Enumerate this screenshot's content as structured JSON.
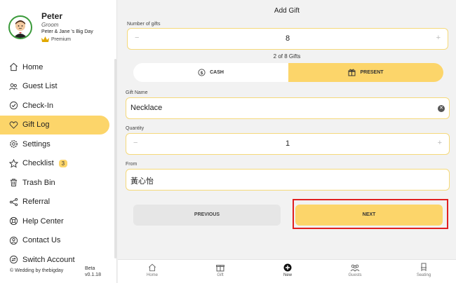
{
  "profile": {
    "name": "Peter",
    "role": "Groom",
    "event": "Peter & Jane 's Big Day",
    "badge": "Premium"
  },
  "sidebar": {
    "items": [
      {
        "label": "Home",
        "icon": "home-icon"
      },
      {
        "label": "Guest List",
        "icon": "guests-icon"
      },
      {
        "label": "Check-In",
        "icon": "check-circle-icon"
      },
      {
        "label": "Gift Log",
        "icon": "heart-icon",
        "active": true
      },
      {
        "label": "Settings",
        "icon": "gear-icon"
      },
      {
        "label": "Checklist",
        "icon": "star-icon",
        "badge": "3"
      },
      {
        "label": "Trash Bin",
        "icon": "trash-icon"
      },
      {
        "label": "Referral",
        "icon": "share-icon"
      },
      {
        "label": "Help Center",
        "icon": "help-icon"
      },
      {
        "label": "Contact Us",
        "icon": "contact-icon"
      },
      {
        "label": "Switch Account",
        "icon": "switch-icon"
      }
    ],
    "footer_copy": "© Wedding by thebigday",
    "footer_beta": "Beta",
    "footer_version": "v0.1.18"
  },
  "main": {
    "title": "Add Gift",
    "num_gifts_label": "Number of gifts",
    "num_gifts_value": "8",
    "minus": "−",
    "plus": "+",
    "counter": "2 of 8 Gifts",
    "toggle_cash": "CASH",
    "toggle_present": "PRESENT",
    "gift_name_label": "Gift Name",
    "gift_name_value": "Necklace",
    "quantity_label": "Quantity",
    "quantity_value": "1",
    "from_label": "From",
    "from_value": "黃心怡",
    "previous_label": "PREVIOUS",
    "next_label": "NEXT"
  },
  "tabs": [
    {
      "label": "Home",
      "icon": "home-icon"
    },
    {
      "label": "Gift",
      "icon": "gift-icon"
    },
    {
      "label": "New",
      "icon": "plus-circle-icon"
    },
    {
      "label": "Guests",
      "icon": "guests-icon"
    },
    {
      "label": "Seating",
      "icon": "chair-icon"
    }
  ],
  "colors": {
    "accent": "#fcd56a",
    "highlight": "#e02020"
  }
}
